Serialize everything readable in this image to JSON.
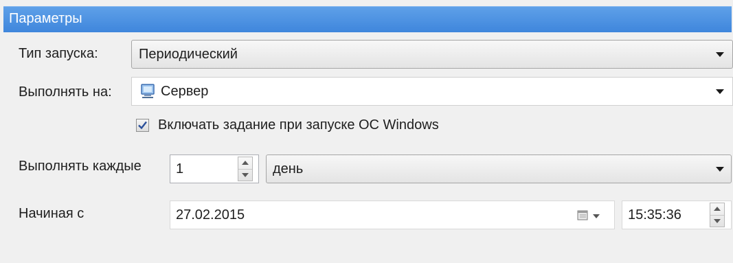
{
  "panel": {
    "title": "Параметры"
  },
  "launch_type": {
    "label": "Тип запуска:",
    "value": "Периодический"
  },
  "run_on": {
    "label": "Выполнять на:",
    "value": "Сервер",
    "icon": "server-icon"
  },
  "windows_startup": {
    "label": "Включать задание при запуске ОС Windows",
    "checked": true
  },
  "repeat": {
    "label": "Выполнять каждые",
    "count": "1",
    "unit": "день"
  },
  "start": {
    "label": "Начиная с",
    "date": "27.02.2015",
    "time": "15:35:36",
    "calendar_icon": "calendar-icon"
  },
  "colors": {
    "header": "#4a8fe0",
    "background": "#f0f0f0"
  }
}
